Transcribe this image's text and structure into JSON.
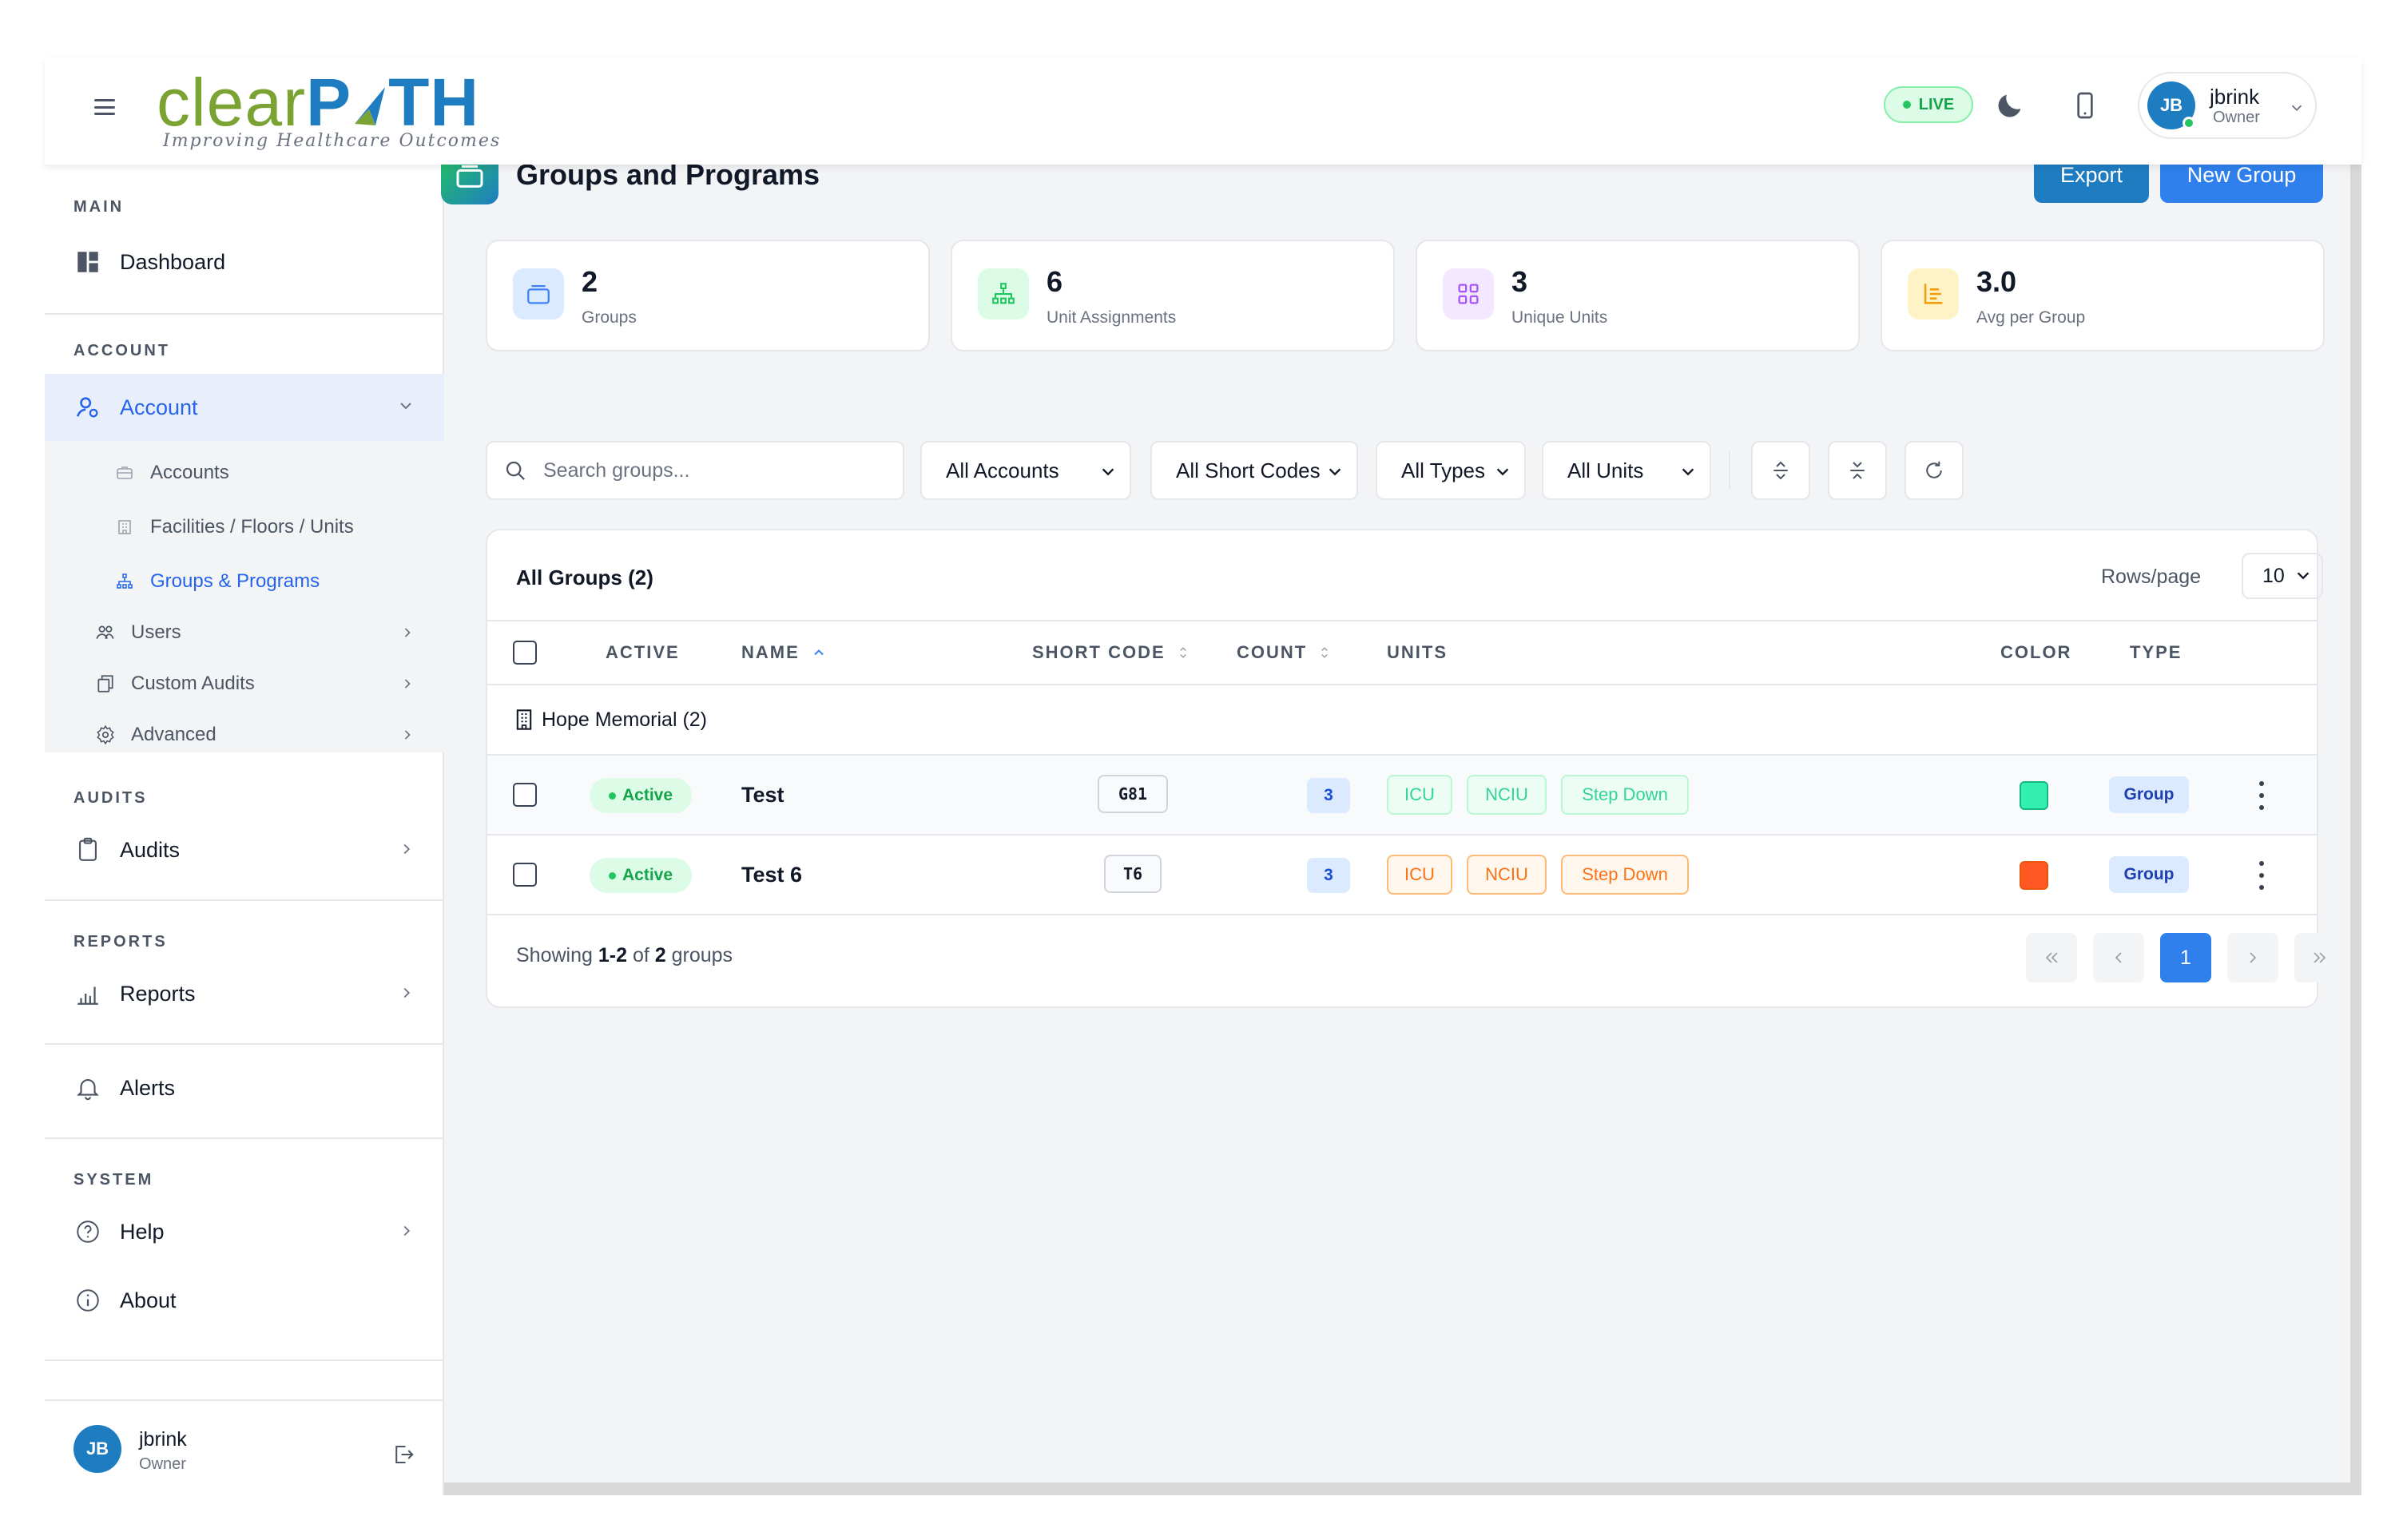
{
  "header": {
    "logo_clear": "clear",
    "logo_path_p": "P",
    "logo_path_rest": "TH",
    "logo_tagline": "Improving Healthcare Outcomes",
    "live_label": "LIVE",
    "user": {
      "initials": "JB",
      "name": "jbrink",
      "role": "Owner"
    }
  },
  "sidebar": {
    "main_title": "MAIN",
    "dashboard": "Dashboard",
    "account_title": "ACCOUNT",
    "account": "Account",
    "account_sub": [
      "Accounts",
      "Facilities / Floors / Units",
      "Groups & Programs"
    ],
    "users": "Users",
    "custom_audits": "Custom Audits",
    "advanced": "Advanced",
    "audits_title": "AUDITS",
    "audits": "Audits",
    "reports_title": "REPORTS",
    "reports": "Reports",
    "alerts": "Alerts",
    "system_title": "SYSTEM",
    "help": "Help",
    "about": "About",
    "footer_user": {
      "initials": "JB",
      "name": "jbrink",
      "role": "Owner"
    }
  },
  "page": {
    "title": "Groups and Programs",
    "export_label": "Export",
    "new_group_label": "New Group"
  },
  "stats": [
    {
      "value": "2",
      "label": "Groups"
    },
    {
      "value": "6",
      "label": "Unit Assignments"
    },
    {
      "value": "3",
      "label": "Unique Units"
    },
    {
      "value": "3.0",
      "label": "Avg per Group"
    }
  ],
  "filters": {
    "search_placeholder": "Search groups...",
    "accounts": "All Accounts",
    "short_codes": "All Short Codes",
    "types": "All Types",
    "units": "All Units"
  },
  "table": {
    "title": "All Groups (2)",
    "rows_per_page_label": "Rows/page",
    "rows_per_page": "10",
    "columns": {
      "active": "ACTIVE",
      "name": "NAME",
      "short_code": "SHORT CODE",
      "count": "COUNT",
      "units": "UNITS",
      "color": "COLOR",
      "type": "TYPE"
    },
    "group_label": "Hope Memorial (2)",
    "rows": [
      {
        "status": "Active",
        "name": "Test",
        "short_code": "G81",
        "count": "3",
        "units": [
          "ICU",
          "NCIU",
          "Step Down"
        ],
        "color": "#34f0b0",
        "type": "Group"
      },
      {
        "status": "Active",
        "name": "Test 6",
        "short_code": "T6",
        "count": "3",
        "units": [
          "ICU",
          "NCIU",
          "Step Down"
        ],
        "color": "#ff5722",
        "type": "Group"
      }
    ],
    "showing_prefix": "Showing ",
    "showing_range": "1-2",
    "showing_of": " of ",
    "showing_total": "2",
    "showing_suffix": " groups",
    "current_page": "1"
  },
  "colors": {
    "brand_blue": "#1e7dc1",
    "brand_green": "#7ba333",
    "primary_button": "#2f80ed"
  }
}
